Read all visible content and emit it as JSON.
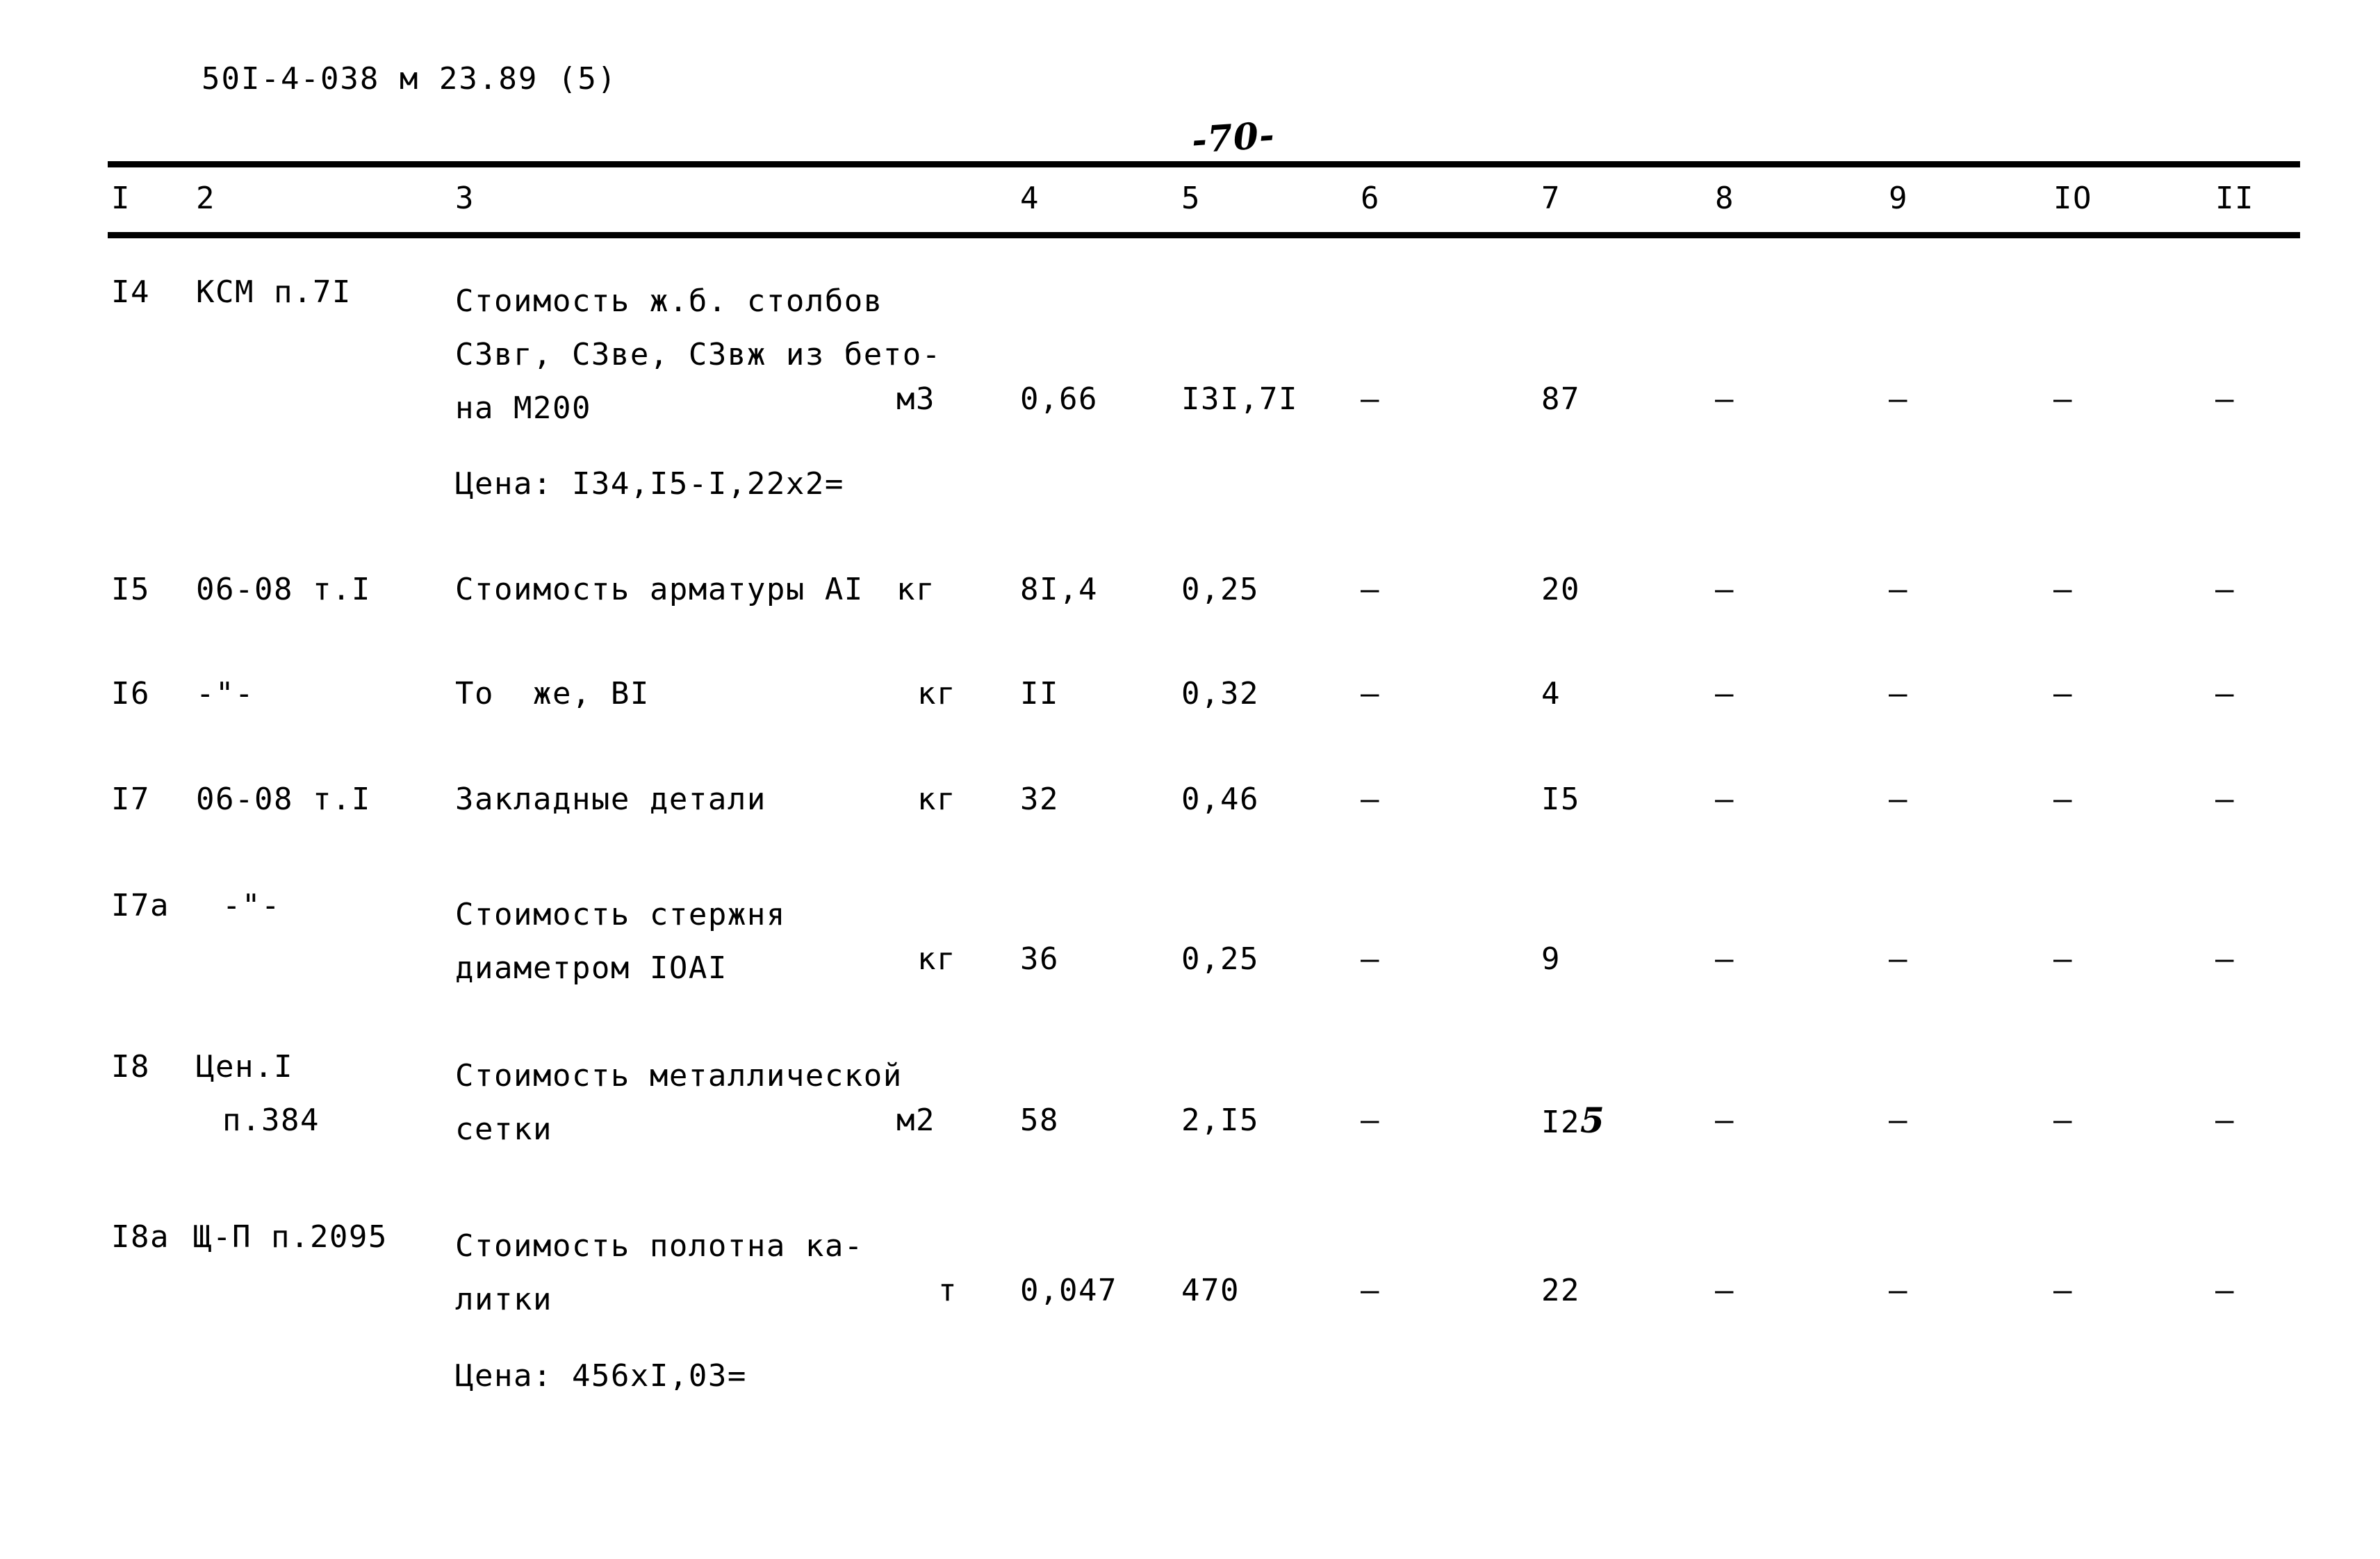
{
  "document": {
    "code_line": "50I-4-038 м 23.89 (5)",
    "page_number": "-70-"
  },
  "table": {
    "column_headers": [
      "I",
      "2",
      "3",
      "4",
      "5",
      "6",
      "7",
      "8",
      "9",
      "IO",
      "II"
    ],
    "rows": [
      {
        "pos": "I4",
        "code": "КСМ п.7I",
        "description_lines": [
          "Стоимость ж.б. столбов",
          "СЗвг, СЗве, СЗвж из бето-",
          "на М200"
        ],
        "unit": "м3",
        "col4": "0,66",
        "col5": "I3I,7I",
        "col6": "–",
        "col7": "87",
        "col8": "–",
        "col9": "–",
        "col10": "–",
        "col11": "–",
        "note": "Цена: I34,I5-I,22x2="
      },
      {
        "pos": "I5",
        "code": "06-08 т.I",
        "description_lines": [
          "Стоимость арматуры АI"
        ],
        "unit": "кг",
        "col4": "8I,4",
        "col5": "0,25",
        "col6": "–",
        "col7": "20",
        "col8": "–",
        "col9": "–",
        "col10": "–",
        "col11": "–",
        "note": ""
      },
      {
        "pos": "I6",
        "code": "-\"-",
        "description_lines": [
          "То  же, ВI"
        ],
        "unit": "кг",
        "col4": "II",
        "col5": "0,32",
        "col6": "–",
        "col7": "4",
        "col8": "–",
        "col9": "–",
        "col10": "–",
        "col11": "–",
        "note": ""
      },
      {
        "pos": "I7",
        "code": "06-08 т.I",
        "description_lines": [
          "Закладные детали"
        ],
        "unit": "кг",
        "col4": "32",
        "col5": "0,46",
        "col6": "–",
        "col7": "I5",
        "col8": "–",
        "col9": "–",
        "col10": "–",
        "col11": "–",
        "note": ""
      },
      {
        "pos": "I7а",
        "code": "-\"-",
        "description_lines": [
          "Стоимость стержня",
          "диаметром IOAI"
        ],
        "unit": "кг",
        "col4": "36",
        "col5": "0,25",
        "col6": "–",
        "col7": "9",
        "col8": "–",
        "col9": "–",
        "col10": "–",
        "col11": "–",
        "note": ""
      },
      {
        "pos": "I8",
        "code": "Цен.I",
        "code_line2": "п.384",
        "description_lines": [
          "Стоимость металлической",
          "сетки"
        ],
        "unit": "м2",
        "col4": "58",
        "col5": "2,I5",
        "col6": "–",
        "col7_typed": "I2",
        "col7_handwritten": "5",
        "col7": "I25",
        "col8": "–",
        "col9": "–",
        "col10": "–",
        "col11": "–",
        "note": ""
      },
      {
        "pos": "I8а",
        "code": "Щ-П п.2095",
        "description_lines": [
          "Стоимость полотна ка-",
          "литки"
        ],
        "unit": "т",
        "col4": "0,047",
        "col5": "470",
        "col6": "–",
        "col7": "22",
        "col8": "–",
        "col9": "–",
        "col10": "–",
        "col11": "–",
        "note": "Цена: 456xI,03="
      }
    ]
  }
}
